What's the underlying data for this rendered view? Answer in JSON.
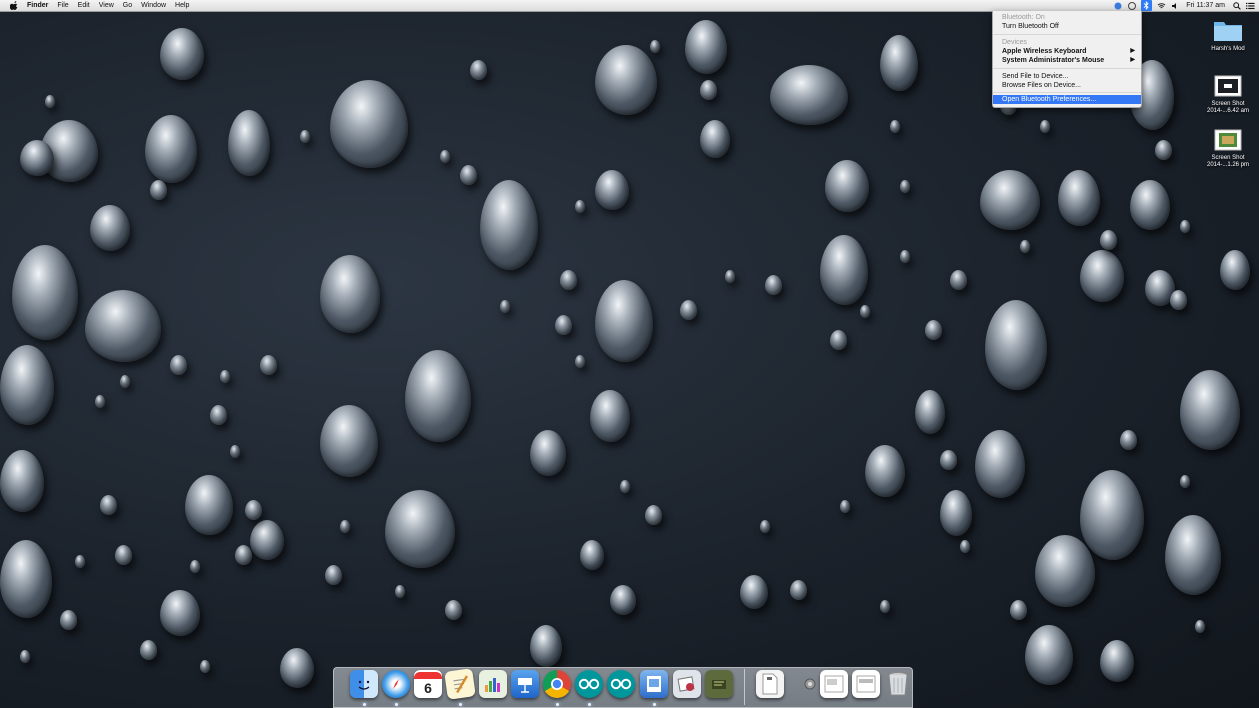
{
  "menubar": {
    "app_name": "Finder",
    "menus": [
      "File",
      "Edit",
      "View",
      "Go",
      "Window",
      "Help"
    ],
    "clock": "Fri 11:37 am"
  },
  "bluetooth_menu": {
    "status": "Bluetooth: On",
    "toggle": "Turn Bluetooth Off",
    "devices_header": "Devices",
    "devices": [
      "Apple Wireless Keyboard",
      "System Administrator's Mouse"
    ],
    "send_file": "Send File to Device...",
    "browse_files": "Browse Files on Device...",
    "preferences": "Open Bluetooth Preferences..."
  },
  "desktop": {
    "icons": [
      {
        "label": "Harsh's Mod",
        "icon": "folder-icon"
      },
      {
        "label": "Screen Shot",
        "sublabel": "2014-...6.42 am",
        "icon": "screenshot-file-icon"
      },
      {
        "label": "Screen Shot",
        "sublabel": "2014-...1.26 pm",
        "icon": "screenshot-file-icon"
      }
    ]
  },
  "dock": {
    "apps": [
      "finder-icon",
      "safari-icon",
      "calendar-icon",
      "textedit-icon",
      "numbers-icon",
      "keynote-icon",
      "chrome-icon",
      "arduino-icon",
      "arduino-icon",
      "preview-icon",
      "mail-preview-icon",
      "utility-icon",
      "document-icon",
      "gear-icon",
      "screenshot-icon",
      "screenshot-icon",
      "trash-icon"
    ],
    "calendar_day": "6"
  },
  "colors": {
    "menu_highlight": "#3478f6",
    "wallpaper": "#1b222b"
  }
}
